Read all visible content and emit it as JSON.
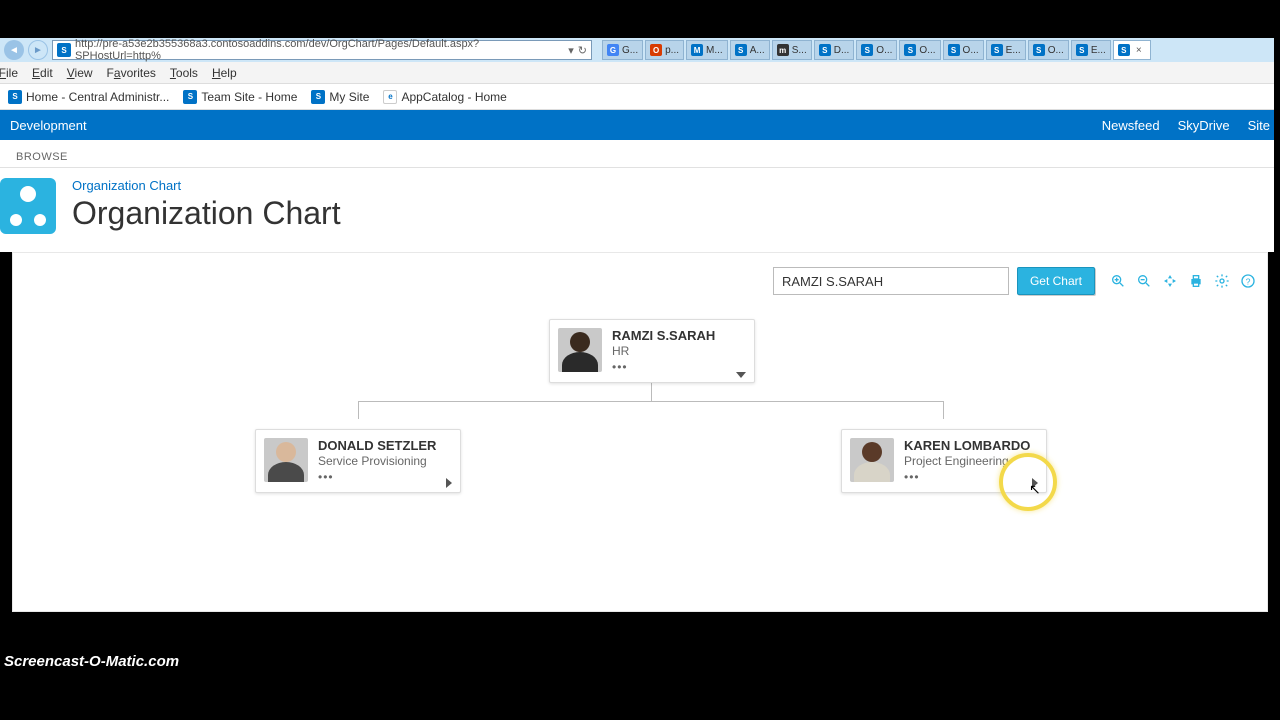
{
  "browser": {
    "url": "http://pre-a53e2b355368a3.contosoaddins.com/dev/OrgChart/Pages/Default.aspx?SPHostUrl=http%",
    "tabs": [
      {
        "icon": "G",
        "label": "G...",
        "color": "#4285f4"
      },
      {
        "icon": "O",
        "label": "p...",
        "color": "#d83b01"
      },
      {
        "icon": "M",
        "label": "M...",
        "color": "#0072c6"
      },
      {
        "icon": "S",
        "label": "A...",
        "color": "#0072c6"
      },
      {
        "icon": "m",
        "label": "S...",
        "color": "#333"
      },
      {
        "icon": "S",
        "label": "D...",
        "color": "#0072c6"
      },
      {
        "icon": "S",
        "label": "O...",
        "color": "#0072c6"
      },
      {
        "icon": "S",
        "label": "O...",
        "color": "#0072c6"
      },
      {
        "icon": "S",
        "label": "O...",
        "color": "#0072c6"
      },
      {
        "icon": "S",
        "label": "E...",
        "color": "#0072c6"
      },
      {
        "icon": "S",
        "label": "O...",
        "color": "#0072c6"
      },
      {
        "icon": "S",
        "label": "E...",
        "color": "#0072c6"
      },
      {
        "icon": "S",
        "label": "",
        "color": "#0072c6",
        "active": true
      }
    ]
  },
  "menu": {
    "file": "File",
    "edit": "Edit",
    "view": "View",
    "favorites": "Favorites",
    "tools": "Tools",
    "help": "Help"
  },
  "favorites": [
    {
      "label": "Home - Central Administr..."
    },
    {
      "label": "Team Site - Home"
    },
    {
      "label": "My Site"
    },
    {
      "label": "AppCatalog - Home"
    }
  ],
  "suite": {
    "left": "Development",
    "right": [
      "Newsfeed",
      "SkyDrive",
      "Site"
    ]
  },
  "ribbon": {
    "browse": "BROWSE"
  },
  "header": {
    "crumb": "Organization Chart",
    "title": "Organization Chart"
  },
  "toolbar": {
    "search_value": "RAMZI S.SARAH",
    "get_label": "Get Chart"
  },
  "chart": {
    "root": {
      "name": "RAMZI S.SARAH",
      "dept": "HR"
    },
    "children": [
      {
        "name": "DONALD SETZLER",
        "dept": "Service Provisioning"
      },
      {
        "name": "KAREN LOMBARDO",
        "dept": "Project Engineering"
      }
    ]
  },
  "watermark": "Screencast-O-Matic.com"
}
